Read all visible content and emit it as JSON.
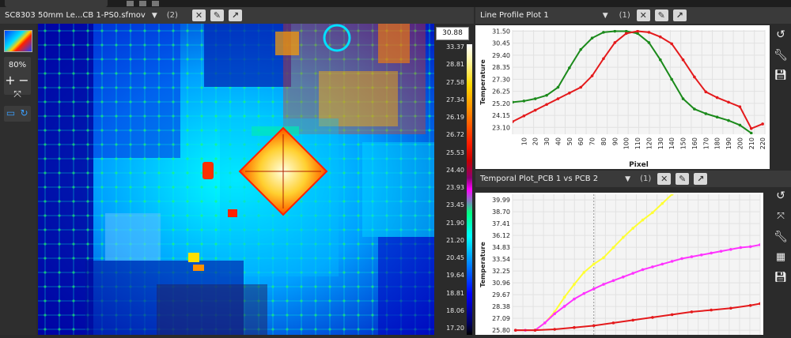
{
  "video_panel": {
    "title": "SC8303 50mm Le...CB 1-PS0.sfmov",
    "count": "(2)",
    "zoom": "80%"
  },
  "colorbar": {
    "max_value": "30.88",
    "ticks": [
      "33.37",
      "28.81",
      "27.58",
      "27.34",
      "26.19",
      "26.72",
      "25.53",
      "24.40",
      "23.93",
      "23.45",
      "21.90",
      "21.20",
      "20.45",
      "19.64",
      "18.81",
      "18.06",
      "17.20"
    ]
  },
  "line_profile": {
    "title": "Line Profile Plot 1",
    "count": "(1)",
    "ylabel": "Temperature",
    "xlabel": "Pixel",
    "yticks": [
      "31.50",
      "30.45",
      "29.40",
      "28.35",
      "27.30",
      "26.25",
      "25.20",
      "24.15",
      "23.10"
    ],
    "xticks": [
      "10",
      "20",
      "30",
      "40",
      "50",
      "60",
      "70",
      "80",
      "90",
      "100",
      "110",
      "120",
      "130",
      "140",
      "150",
      "160",
      "170",
      "180",
      "190",
      "200",
      "210",
      "220"
    ]
  },
  "temporal": {
    "title": "Temporal Plot_PCB 1 vs PCB 2",
    "count": "(1)",
    "ylabel": "Temperature",
    "yticks": [
      "39.99",
      "38.70",
      "37.41",
      "36.12",
      "34.83",
      "33.54",
      "32.25",
      "30.96",
      "29.67",
      "28.38",
      "27.09",
      "25.80"
    ]
  },
  "colors": {
    "panel_bg": "#2b2b2b",
    "header_bg": "#3a3a3a",
    "series_red": "#e41a1c",
    "series_green": "#1b8a1b",
    "series_yellow": "#ffff33",
    "series_magenta": "#ff33ff"
  },
  "chart_data": [
    {
      "type": "line",
      "title": "Line Profile Plot 1",
      "xlabel": "Pixel",
      "ylabel": "Temperature",
      "xlim": [
        0,
        222
      ],
      "ylim": [
        22.5,
        31.6
      ],
      "series": [
        {
          "color": "#1b8a1b",
          "x": [
            0,
            10,
            20,
            30,
            40,
            50,
            60,
            70,
            80,
            90,
            100,
            110,
            120,
            130,
            140,
            150,
            160,
            170,
            180,
            190,
            200,
            210
          ],
          "y": [
            25.3,
            25.4,
            25.6,
            25.9,
            26.6,
            28.3,
            29.9,
            30.9,
            31.4,
            31.5,
            31.5,
            31.3,
            30.5,
            29.0,
            27.3,
            25.6,
            24.7,
            24.3,
            24.0,
            23.7,
            23.3,
            22.6
          ]
        },
        {
          "color": "#e41a1c",
          "x": [
            0,
            10,
            20,
            30,
            40,
            50,
            60,
            70,
            80,
            90,
            100,
            110,
            120,
            130,
            140,
            150,
            160,
            170,
            180,
            190,
            200,
            210,
            220
          ],
          "y": [
            23.6,
            24.1,
            24.6,
            25.1,
            25.6,
            26.1,
            26.6,
            27.6,
            29.1,
            30.5,
            31.3,
            31.5,
            31.4,
            31.0,
            30.4,
            29.0,
            27.5,
            26.2,
            25.7,
            25.3,
            24.9,
            23.0,
            23.4
          ]
        }
      ]
    },
    {
      "type": "line",
      "title": "Temporal Plot_PCB 1 vs PCB 2",
      "ylabel": "Temperature",
      "ylim": [
        25.3,
        40.6
      ],
      "series": [
        {
          "color": "#ffff33",
          "x": [
            0,
            10,
            20,
            30,
            40,
            50,
            60,
            70,
            80,
            90,
            100,
            110,
            120,
            130,
            140,
            150,
            160
          ],
          "y": [
            25.8,
            25.8,
            25.8,
            26.6,
            27.8,
            29.4,
            30.8,
            32.1,
            33.0,
            33.7,
            34.8,
            35.9,
            36.9,
            37.8,
            38.6,
            39.6,
            40.6
          ]
        },
        {
          "color": "#ff33ff",
          "x": [
            0,
            10,
            20,
            30,
            40,
            50,
            60,
            70,
            80,
            90,
            100,
            110,
            120,
            130,
            140,
            150,
            160,
            170,
            180,
            190,
            200,
            210,
            220,
            230,
            240,
            250
          ],
          "y": [
            25.8,
            25.8,
            25.8,
            26.6,
            27.6,
            28.4,
            29.2,
            29.8,
            30.3,
            30.8,
            31.2,
            31.6,
            32.0,
            32.4,
            32.7,
            33.0,
            33.3,
            33.6,
            33.8,
            34.0,
            34.2,
            34.4,
            34.6,
            34.8,
            34.9,
            35.1
          ]
        },
        {
          "color": "#e41a1c",
          "x": [
            0,
            20,
            40,
            60,
            80,
            100,
            120,
            140,
            160,
            180,
            200,
            220,
            240,
            250
          ],
          "y": [
            25.8,
            25.8,
            25.9,
            26.1,
            26.3,
            26.6,
            26.9,
            27.2,
            27.5,
            27.8,
            28.0,
            28.2,
            28.5,
            28.7
          ]
        }
      ]
    }
  ]
}
